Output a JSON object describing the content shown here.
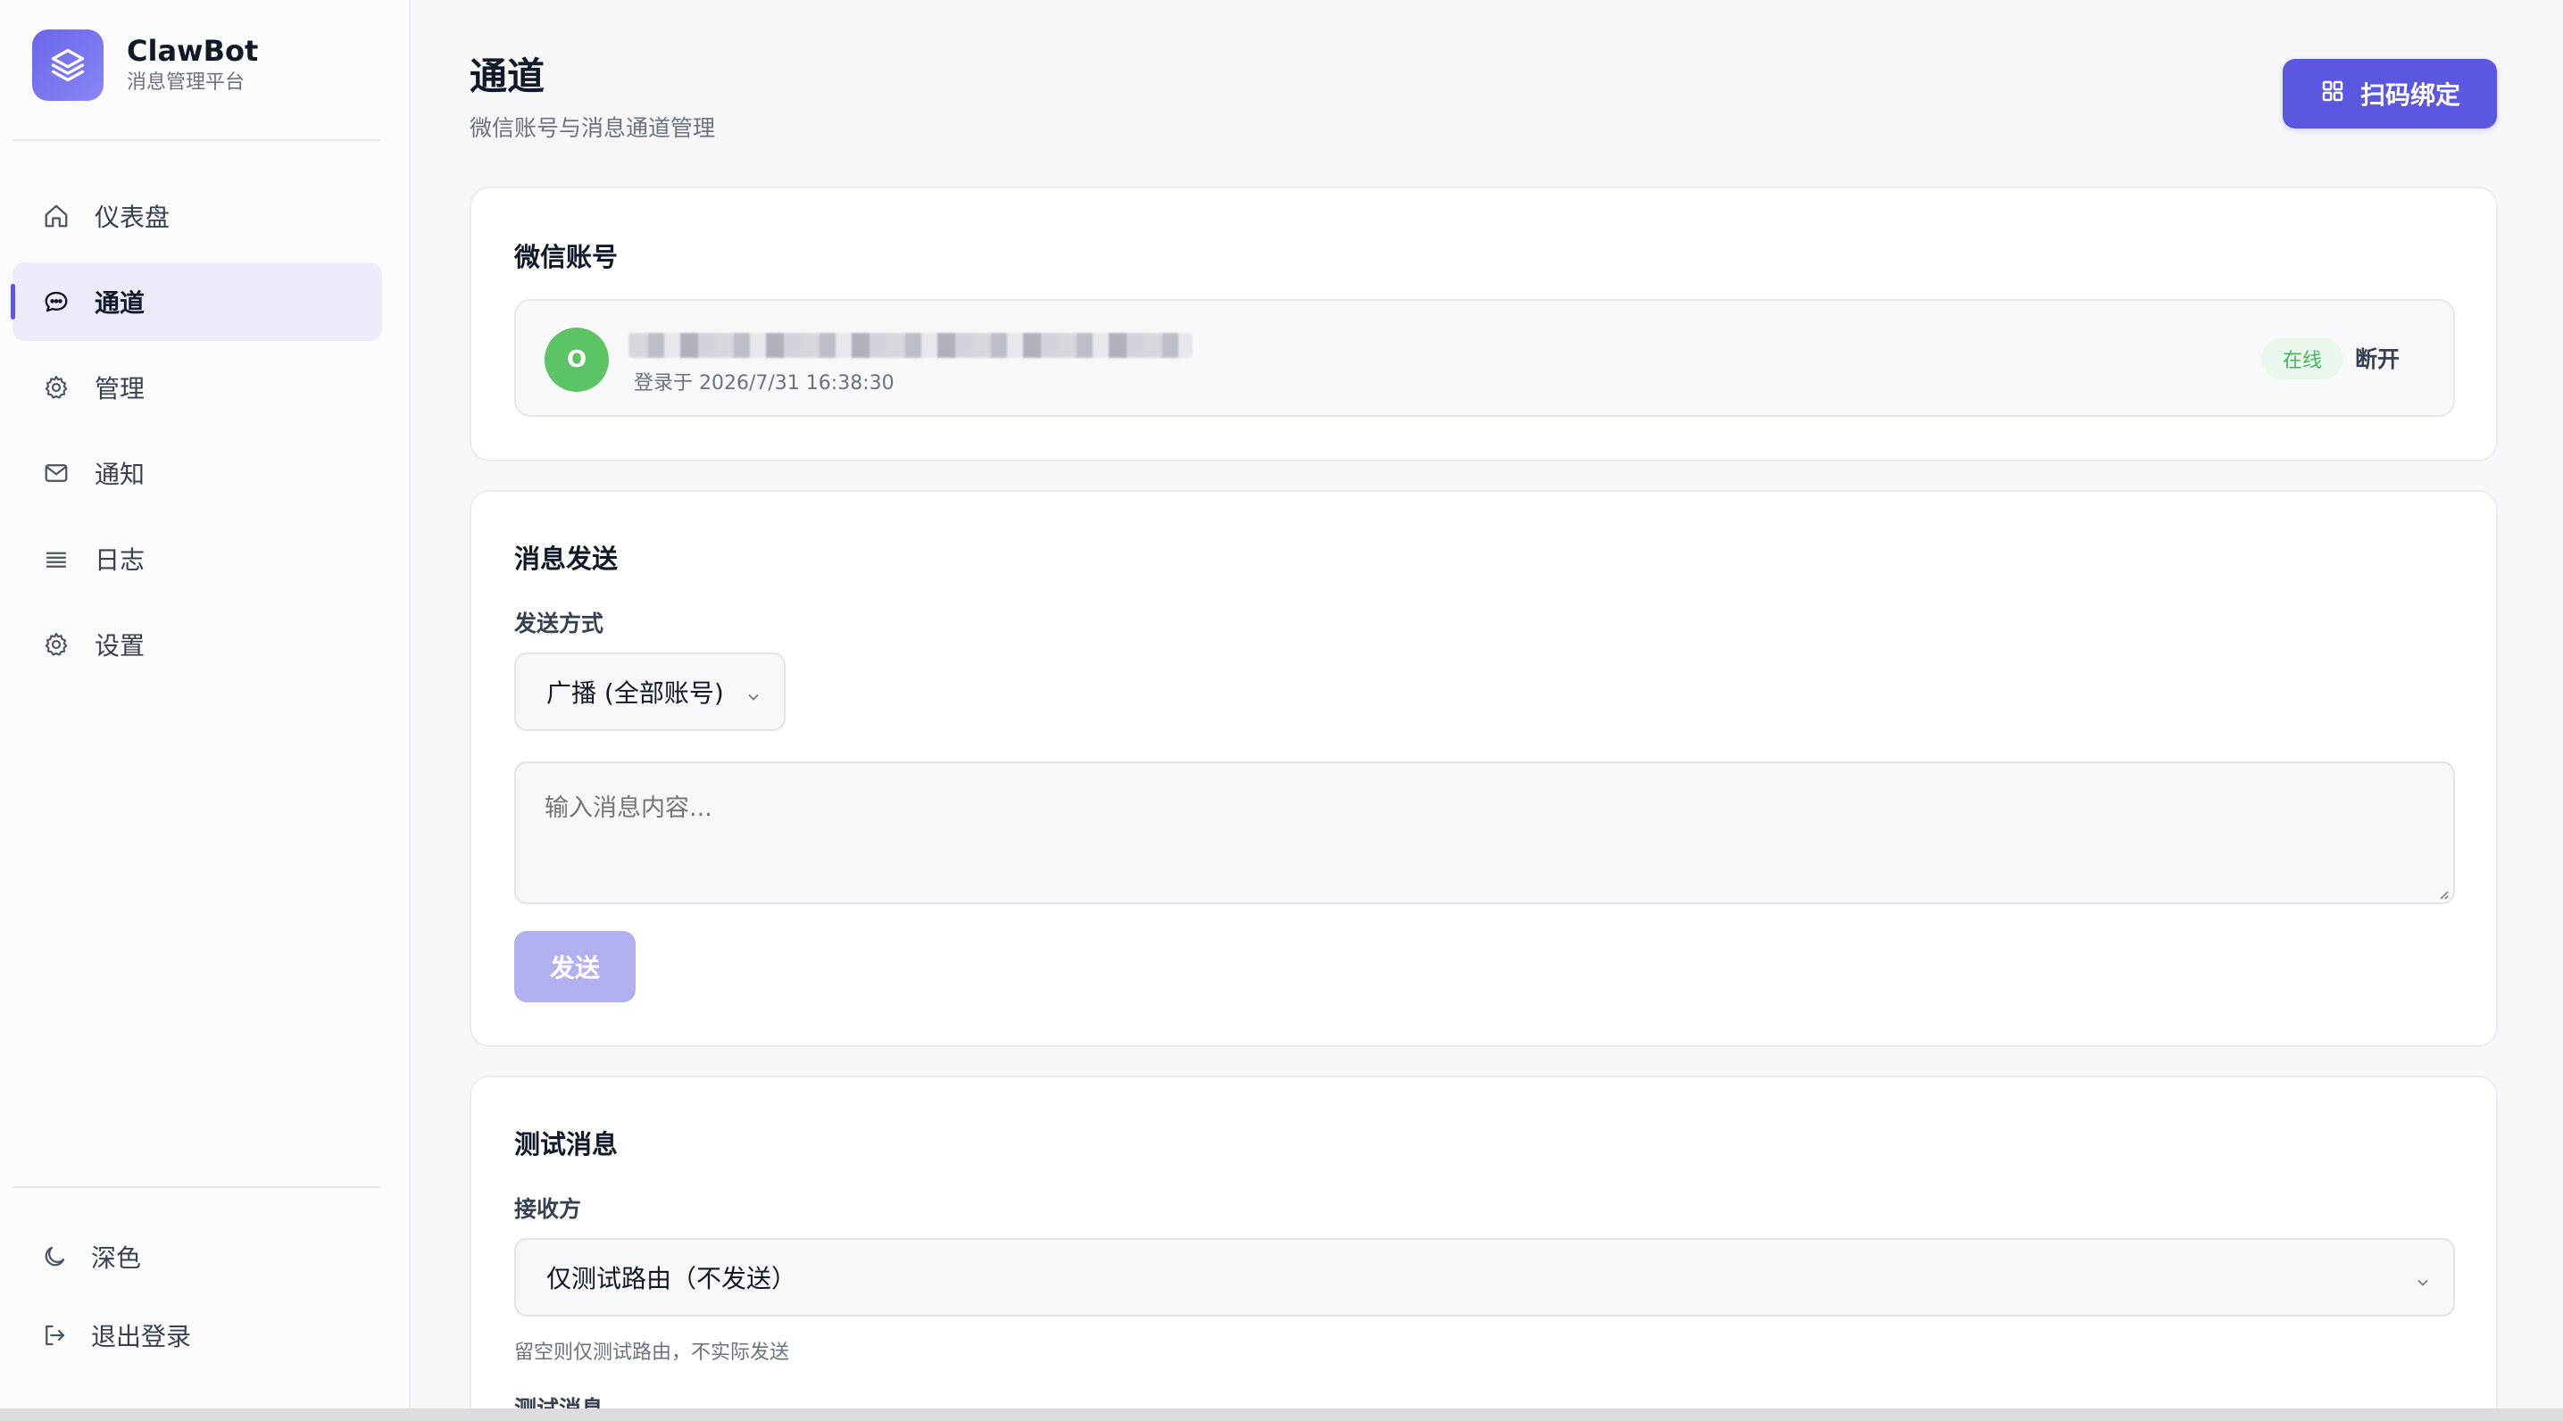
{
  "brand": {
    "name": "ClawBot",
    "subtitle": "消息管理平台"
  },
  "nav": {
    "items": [
      {
        "label": "仪表盘",
        "icon": "home-icon",
        "active": false
      },
      {
        "label": "通道",
        "icon": "chat-icon",
        "active": true
      },
      {
        "label": "管理",
        "icon": "gear-icon",
        "active": false
      },
      {
        "label": "通知",
        "icon": "mail-icon",
        "active": false
      },
      {
        "label": "日志",
        "icon": "list-icon",
        "active": false
      },
      {
        "label": "设置",
        "icon": "gear-icon",
        "active": false
      }
    ],
    "theme_label": "深色",
    "logout_label": "退出登录"
  },
  "header": {
    "title": "通道",
    "subtitle": "微信账号与消息通道管理",
    "scan_button": "扫码绑定"
  },
  "accounts": {
    "title": "微信账号",
    "item": {
      "avatar_letter": "O",
      "login_time": "登录于 2026/7/31 16:38:30",
      "status": "在线",
      "disconnect": "断开"
    }
  },
  "send": {
    "title": "消息发送",
    "method_label": "发送方式",
    "method_value": "广播 (全部账号)",
    "message_placeholder": "输入消息内容...",
    "send_button": "发送"
  },
  "test": {
    "title": "测试消息",
    "receiver_label": "接收方",
    "receiver_value": "仅测试路由（不发送）",
    "hint": "留空则仅测试路由，不实际发送",
    "message_label": "测试消息"
  },
  "colors": {
    "accent": "#5b57e0",
    "accent_disabled": "#b3b0f2",
    "online_green": "#46b55a",
    "avatar_green": "#5cc464"
  }
}
